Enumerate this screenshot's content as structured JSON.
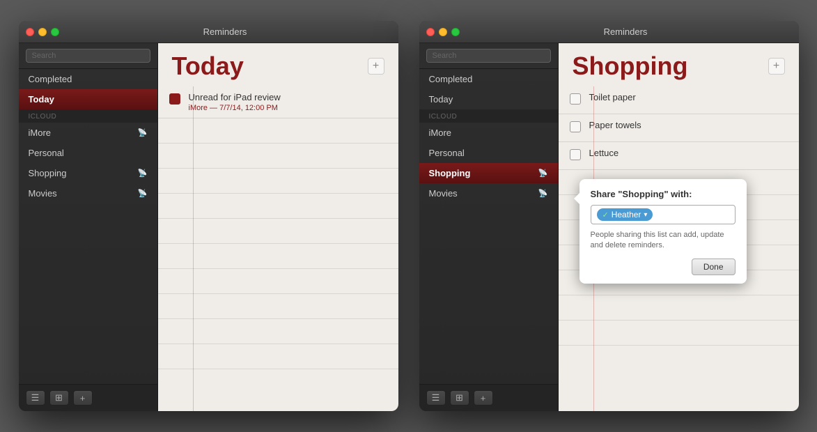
{
  "app": {
    "title": "Reminders"
  },
  "window1": {
    "title": "Reminders",
    "search_placeholder": "Search",
    "sidebar": {
      "items": [
        {
          "id": "completed",
          "label": "Completed",
          "active": false
        },
        {
          "id": "today",
          "label": "Today",
          "active": true
        },
        {
          "id": "icloud_header",
          "label": "iCloud",
          "type": "header"
        },
        {
          "id": "imore",
          "label": "iMore",
          "has_rss": true
        },
        {
          "id": "personal",
          "label": "Personal"
        },
        {
          "id": "shopping",
          "label": "Shopping",
          "has_rss": true
        },
        {
          "id": "movies",
          "label": "Movies",
          "has_rss": true
        }
      ]
    },
    "toolbar": {
      "list_icon": "☰",
      "grid_icon": "⊞",
      "add_icon": "+"
    },
    "main": {
      "title": "Today",
      "add_btn": "+",
      "reminders": [
        {
          "id": "unread-ipad",
          "text": "Unread for iPad review",
          "subtitle": "iMore — 7/7/14, 12:00 PM",
          "checked": false
        }
      ]
    }
  },
  "window2": {
    "title": "Reminders",
    "search_placeholder": "Search",
    "sidebar": {
      "items": [
        {
          "id": "completed",
          "label": "Completed",
          "active": false
        },
        {
          "id": "today",
          "label": "Today",
          "active": false
        },
        {
          "id": "icloud_header",
          "label": "iCloud",
          "type": "header"
        },
        {
          "id": "imore",
          "label": "iMore"
        },
        {
          "id": "personal",
          "label": "Personal"
        },
        {
          "id": "shopping",
          "label": "Shopping",
          "active": true,
          "has_rss": true
        },
        {
          "id": "movies",
          "label": "Movies",
          "has_rss": true
        }
      ]
    },
    "toolbar": {
      "list_icon": "☰",
      "grid_icon": "⊞",
      "add_icon": "+"
    },
    "main": {
      "title": "Shopping",
      "add_btn": "+",
      "reminders": [
        {
          "id": "toilet-paper",
          "text": "Toilet paper",
          "checked": false
        },
        {
          "id": "paper-towels",
          "text": "Paper towels",
          "checked": false
        },
        {
          "id": "lettuce",
          "text": "Lettuce",
          "checked": false
        }
      ]
    },
    "share_popup": {
      "title": "Share \"Shopping\" with:",
      "person": "Heather",
      "description": "People sharing this list can add, update and delete reminders.",
      "done_label": "Done"
    }
  }
}
